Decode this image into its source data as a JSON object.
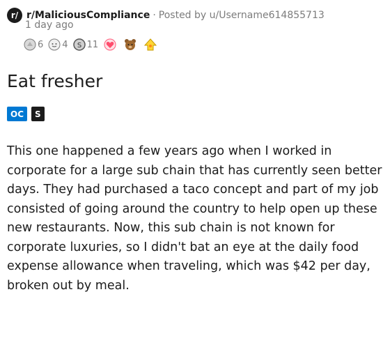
{
  "post": {
    "subreddit_icon_text": "r/",
    "subreddit": "r/MaliciousCompliance",
    "separator": "·",
    "posted_by": "Posted by u/Username614855713",
    "age": "1 day ago",
    "awards": [
      {
        "icon": "silver-hands-award-icon",
        "count": "6"
      },
      {
        "icon": "face-award-icon",
        "count": "4"
      },
      {
        "icon": "silver-coin-award-icon",
        "count": "11"
      },
      {
        "icon": "heart-award-icon",
        "count": ""
      },
      {
        "icon": "bear-award-icon",
        "count": ""
      },
      {
        "icon": "up-arrow-award-icon",
        "count": ""
      }
    ],
    "title": "Eat fresher",
    "flairs": [
      {
        "label": "OC",
        "color": "#0079d3"
      },
      {
        "label": "S",
        "color": "#1c1c1c"
      }
    ],
    "body": "This one happened a few years ago when I worked in corporate for a large sub chain that has currently seen better days. They had purchased a taco concept and part of my job consisted of going around the country to help open up these new restaurants. Now, this sub chain is not known for corporate luxuries, so I didn't bat an eye at the daily food expense allowance when traveling, which was $42 per day, broken out by meal."
  },
  "colors": {
    "text": "#1c1c1c",
    "meta": "#7c7c7c",
    "accent_blue": "#0079d3"
  }
}
